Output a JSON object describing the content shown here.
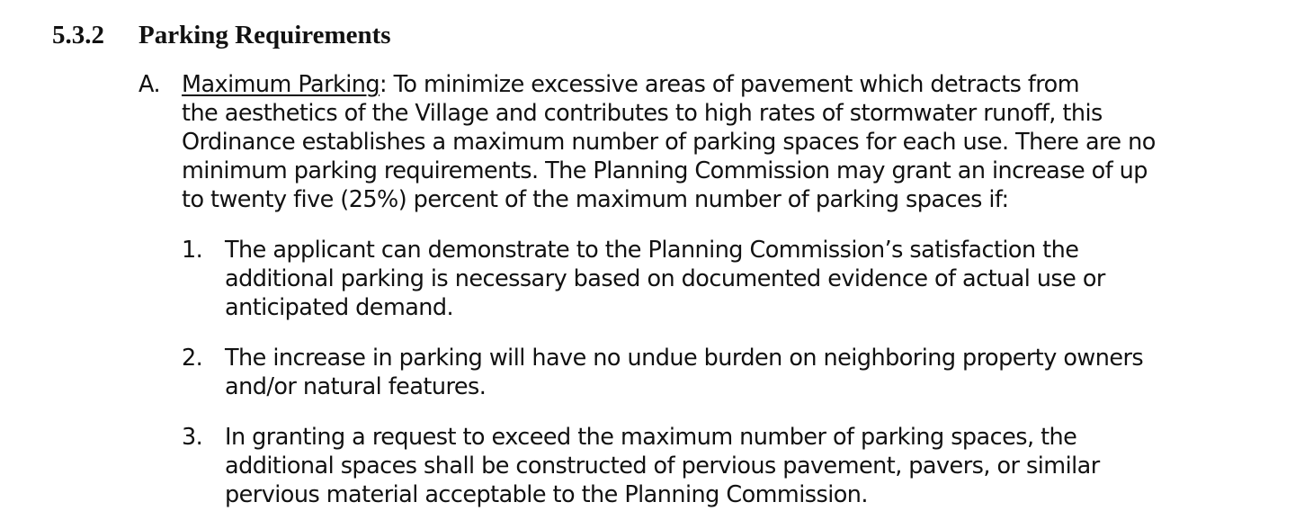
{
  "section": {
    "number": "5.3.2",
    "title": "Parking Requirements"
  },
  "item_a": {
    "marker": "A.",
    "term": "Maximum Parking",
    "term_suffix": ": To minimize excessive areas of pavement which detracts from",
    "lines": [
      "the aesthetics of the Village and contributes to high rates of stormwater runoff, this",
      "Ordinance establishes a maximum number of parking spaces for each use. There are no",
      "minimum parking requirements. The Planning Commission may grant an increase of up",
      "to twenty five (25%) percent of the maximum number of parking spaces if:"
    ]
  },
  "items": [
    {
      "marker": "1.",
      "lines": [
        "The applicant can demonstrate to the Planning Commission’s satisfaction the",
        "additional parking is necessary based on documented evidence of actual use or",
        "anticipated demand."
      ]
    },
    {
      "marker": "2.",
      "lines": [
        "The increase in parking will have no undue burden on neighboring property owners",
        "and/or natural features."
      ]
    },
    {
      "marker": "3.",
      "lines": [
        "In granting a request to exceed the maximum number of parking spaces, the",
        "additional spaces shall be constructed of pervious pavement, pavers, or similar",
        "pervious material acceptable to the Planning Commission."
      ]
    }
  ]
}
